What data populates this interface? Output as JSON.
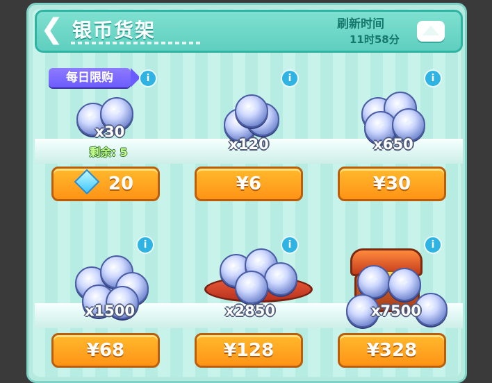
{
  "header": {
    "back_icon": "chevron-left-icon",
    "title": "银币货架",
    "refresh_label": "刷新时间",
    "refresh_time": "11时58分",
    "collapse_icon": "triangle-up-icon"
  },
  "daily_badge": "每日限购",
  "items": [
    {
      "count": "x30",
      "remaining": "剩余: 5",
      "price": "20",
      "currency_icon": "diamond-icon"
    },
    {
      "count": "x120",
      "price": "¥6"
    },
    {
      "count": "x650",
      "price": "¥30"
    },
    {
      "count": "x1500",
      "price": "¥68"
    },
    {
      "count": "x2850",
      "price": "¥128"
    },
    {
      "count": "x7500",
      "price": "¥328"
    }
  ],
  "info_label": "i",
  "colors": {
    "panel": "#b7eadf",
    "header": "#5fcfbf",
    "button": "#ff9f1f",
    "info": "#2fb3e3",
    "badge": "#6b5cff"
  }
}
